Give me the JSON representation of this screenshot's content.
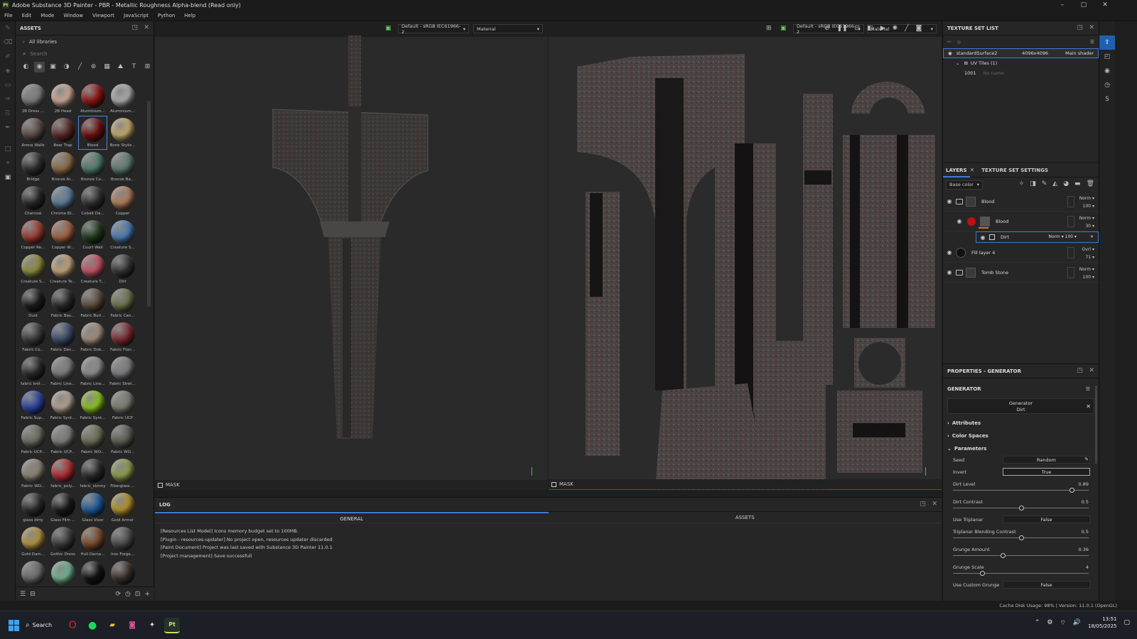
{
  "window": {
    "title": "Adobe Substance 3D Painter - PBR - Metallic Roughness Alpha-blend (Read only)",
    "logo": "Pt",
    "minimize": "–",
    "maximize": "▢",
    "close": "✕"
  },
  "menu": [
    "File",
    "Edit",
    "Mode",
    "Window",
    "Viewport",
    "JavaScript",
    "Python",
    "Help"
  ],
  "assets": {
    "title": "ASSETS",
    "library": "All libraries",
    "search_placeholder": "Search",
    "materials": [
      {
        "name": "2B Dress ...",
        "color": "#7a7a7a"
      },
      {
        "name": "2B Head",
        "color": "#c9a693"
      },
      {
        "name": "Aluminium...",
        "color": "#8b1412"
      },
      {
        "name": "Aluminium...",
        "color": "#a9a9a9"
      },
      {
        "name": "Arena Walls",
        "color": "#5a4a45"
      },
      {
        "name": "Bear Trap",
        "color": "#5a2a26"
      },
      {
        "name": "Blood",
        "color": "#6e0f10",
        "selected": true
      },
      {
        "name": "Bone Styliz...",
        "color": "#c2a66a"
      },
      {
        "name": "Bridge",
        "color": "#2e2e2e"
      },
      {
        "name": "Bronze Ar...",
        "color": "#8a6a45"
      },
      {
        "name": "Bronze Co...",
        "color": "#4d7a6a"
      },
      {
        "name": "Bronze Ba...",
        "color": "#5f7a70"
      },
      {
        "name": "Charcoal",
        "color": "#262626"
      },
      {
        "name": "Chrome Bl...",
        "color": "#5a7a98"
      },
      {
        "name": "Cobalt Da...",
        "color": "#303030"
      },
      {
        "name": "Copper",
        "color": "#b07a5a"
      },
      {
        "name": "Copper Re...",
        "color": "#9a3a30"
      },
      {
        "name": "Copper W...",
        "color": "#a06040"
      },
      {
        "name": "Court Wall",
        "color": "#1f3a1a"
      },
      {
        "name": "Creature S...",
        "color": "#4a7ab0"
      },
      {
        "name": "Creature S...",
        "color": "#8a8a3a"
      },
      {
        "name": "Creature Te...",
        "color": "#c0a07a"
      },
      {
        "name": "Creature T...",
        "color": "#c05060"
      },
      {
        "name": "Dirt",
        "color": "#333333"
      },
      {
        "name": "Dust",
        "color": "#1c1c1c"
      },
      {
        "name": "Fabric Bas...",
        "color": "#2a2a2a"
      },
      {
        "name": "Fabric Burl...",
        "color": "#5a4a3a"
      },
      {
        "name": "Fabric Can...",
        "color": "#6a704a"
      },
      {
        "name": "Fabric Co...",
        "color": "#3a3a3a"
      },
      {
        "name": "Fabric Den...",
        "color": "#3a4a6a"
      },
      {
        "name": "Fabric Dob...",
        "color": "#a08a7a"
      },
      {
        "name": "Fabric Flan...",
        "color": "#7a2a30"
      },
      {
        "name": "fabric knit ...",
        "color": "#2a2a2a"
      },
      {
        "name": "Fabric Line...",
        "color": "#7a7a7a"
      },
      {
        "name": "Fabric Line...",
        "color": "#8a8a8a"
      },
      {
        "name": "Fabric Stret...",
        "color": "#7a7a80"
      },
      {
        "name": "Fabric Sup...",
        "color": "#2a40a0"
      },
      {
        "name": "Fabric Synt...",
        "color": "#b0a090"
      },
      {
        "name": "Fabric Synt...",
        "color": "#8ac020"
      },
      {
        "name": "Fabric UCP",
        "color": "#7a7a70"
      },
      {
        "name": "Fabric UCP...",
        "color": "#6a6a60"
      },
      {
        "name": "Fabric UCP...",
        "color": "#7a7a78"
      },
      {
        "name": "Fabric WO...",
        "color": "#6a6a50"
      },
      {
        "name": "Fabric WO...",
        "color": "#5a5a50"
      },
      {
        "name": "Fabric WO...",
        "color": "#8a8070"
      },
      {
        "name": "fabric_poly...",
        "color": "#b02a30"
      },
      {
        "name": "fabric_skinny",
        "color": "#2a2a2a"
      },
      {
        "name": "Fiberglass ...",
        "color": "#8a9a4a"
      },
      {
        "name": "glass dirty",
        "color": "#2a2a2a"
      },
      {
        "name": "Glass Film ...",
        "color": "#1a1a1a"
      },
      {
        "name": "Glass Visor",
        "color": "#1a5a9a"
      },
      {
        "name": "Gold Armor",
        "color": "#b0902a"
      },
      {
        "name": "Gold Dam...",
        "color": "#b09040"
      },
      {
        "name": "Gothic Dress",
        "color": "#3a3a3a"
      },
      {
        "name": "Hull Dama...",
        "color": "#7a4a2a"
      },
      {
        "name": "Iron Forge...",
        "color": "#4a4a4a"
      },
      {
        "name": "",
        "color": "#6a6a6a"
      },
      {
        "name": "",
        "color": "#70b090"
      },
      {
        "name": "",
        "color": "#121212"
      },
      {
        "name": "",
        "color": "#3a3028"
      }
    ]
  },
  "viewport3d": {
    "colorspace": "Default - sRGB IEC61966-2",
    "channel": "Material",
    "mask_label": "MASK"
  },
  "viewport2d": {
    "colorspace": "Default - sRGB IEC61966-2",
    "channel": "Material",
    "mask_label": "MASK"
  },
  "log": {
    "title": "LOG",
    "tabs": [
      "GENERAL",
      "ASSETS"
    ],
    "lines": [
      "[Resources List Model] Icons memory budget set to 100MB.",
      "[Plugin - resources-updater] No project open, resources updater discarded",
      "[Paint Document] Project was last saved with Substance 3D Painter 11.0.1",
      "[Project management] Save successfull"
    ]
  },
  "texture_set_list": {
    "title": "TEXTURE SET LIST",
    "surface": "standardSurface2",
    "resolution": "4096x4096",
    "shader": "Main shader",
    "uv_tiles": "UV Tiles (1)",
    "tile_id": "1001",
    "tile_name": "No name"
  },
  "layers": {
    "tab_layers": "LAYERS",
    "tab_settings": "TEXTURE SET SETTINGS",
    "channel": "Base color",
    "items": [
      {
        "name": "Blood",
        "blend": "Norm",
        "opacity": "100"
      },
      {
        "name": "Blood",
        "blend": "Norm",
        "opacity": "30"
      },
      {
        "name": "Dirt",
        "blend": "Norm",
        "opacity": "100"
      },
      {
        "name": "Fill layer 4",
        "blend": "Ovrl",
        "opacity": "71"
      },
      {
        "name": "Tomb Stone",
        "blend": "Norm",
        "opacity": "100"
      }
    ]
  },
  "properties": {
    "title": "PROPERTIES - GENERATOR",
    "section": "GENERATOR",
    "generator_label": "Generator",
    "generator_name": "Dirt",
    "groups": [
      "Attributes",
      "Color Spaces",
      "Parameters"
    ],
    "seed_label": "Seed",
    "seed_value": "Random",
    "invert_label": "Invert",
    "invert_value": "True",
    "dirt_level_label": "Dirt Level",
    "dirt_level": "0.89",
    "dirt_contrast_label": "Dirt Contrast",
    "dirt_contrast": "0.5",
    "use_triplanar_label": "Use Triplanar",
    "use_triplanar": "False",
    "triplanar_label": "Triplanar Blending Contrast",
    "triplanar": "0.5",
    "grunge_amount_label": "Grunge Amount",
    "grunge_amount": "0.36",
    "grunge_scale_label": "Grunge Scale",
    "grunge_scale": "4",
    "custom_grunge_label": "Use Custom Grunge",
    "custom_grunge": "False"
  },
  "status": {
    "text": "Cache Disk Usage:  98% | Version: 11.0.1 (OpenGL)"
  },
  "taskbar": {
    "search": "Search",
    "time": "13:51",
    "date": "18/05/2025"
  }
}
